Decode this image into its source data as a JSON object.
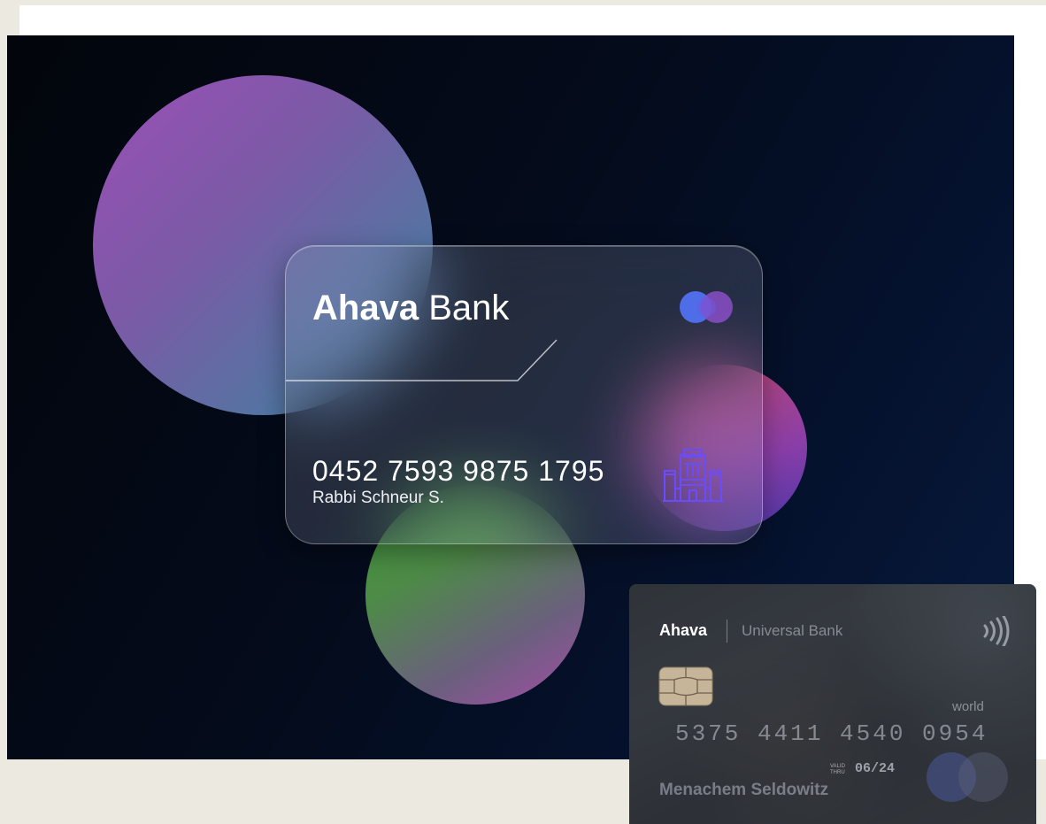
{
  "glass_card": {
    "brand_bold": "Ahava",
    "brand_light": "Bank",
    "card_number": "0452  7593  9875  1795",
    "cardholder": "Rabbi Schneur S.",
    "network_icon": "mastercard-logo-icon",
    "emblem_icon": "temple-icon"
  },
  "photo_card": {
    "brand": "Ahava",
    "subtitle": "Universal Bank",
    "tier": "world",
    "card_number": "5375  4411  4540  0954",
    "valid_line1": "VALID",
    "valid_line2": "THRU",
    "expiry": "06/24",
    "cardholder": "Menachem Seldowitz",
    "chip_icon": "chip-icon",
    "contactless_icon": "contactless-icon",
    "network_icon": "mastercard-logo-icon"
  },
  "colors": {
    "background": "#ece9e0",
    "scene_dark": "#040b1b",
    "blob_purple": "#9b4fb7",
    "blob_red": "#c4486a",
    "blob_green": "#3f9a3a",
    "emblem": "#6a4cff"
  }
}
